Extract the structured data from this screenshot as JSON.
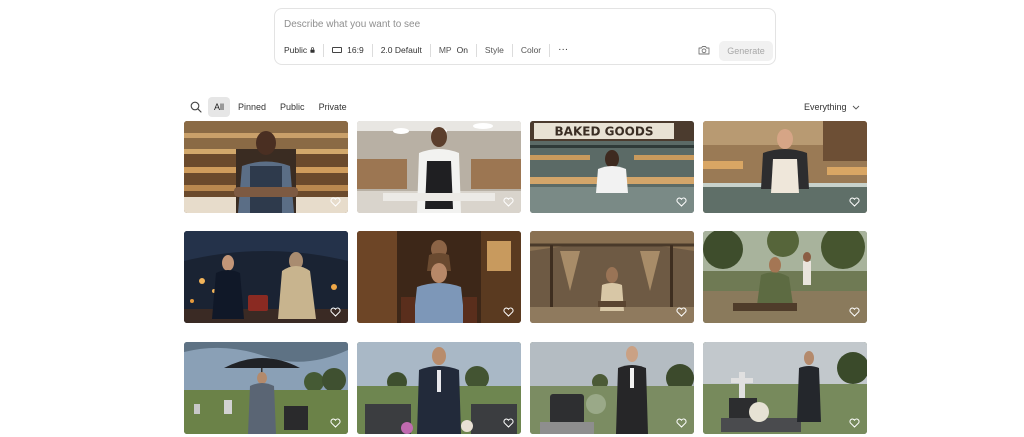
{
  "prompt": {
    "placeholder": "Describe what you want to see",
    "value": ""
  },
  "toolbar": {
    "visibility_label": "Public",
    "aspect_ratio_label": "16:9",
    "model_label": "2.0 Default",
    "mp_label": "MP",
    "mp_state": "On",
    "style_label": "Style",
    "color_label": "Color",
    "more_label": "···",
    "generate_label": "Generate"
  },
  "filters": {
    "tabs": [
      {
        "label": "All",
        "active": true
      },
      {
        "label": "Pinned",
        "active": false
      },
      {
        "label": "Public",
        "active": false
      },
      {
        "label": "Private",
        "active": false
      }
    ],
    "scope_label": "Everything"
  },
  "gallery": {
    "images": [
      {
        "subject": "baker-arms-crossed-bakery",
        "palette": "warm"
      },
      {
        "subject": "baker-leaning-on-counter",
        "palette": "bright"
      },
      {
        "subject": "baker-under-baked-goods-sign",
        "palette": "teal"
      },
      {
        "subject": "baker-at-display-case",
        "palette": "warm"
      },
      {
        "subject": "man-with-fortune-teller",
        "palette": "night"
      },
      {
        "subject": "man-in-barber-chair",
        "palette": "amber"
      },
      {
        "subject": "man-seated-in-thatched-hut",
        "palette": "earth"
      },
      {
        "subject": "man-seated-in-park",
        "palette": "green"
      },
      {
        "subject": "man-with-umbrella-cemetery",
        "palette": "sky"
      },
      {
        "subject": "man-in-suit-at-grave",
        "palette": "sky"
      },
      {
        "subject": "man-at-headstone",
        "palette": "overcast"
      },
      {
        "subject": "man-by-cross-grave",
        "palette": "overcast"
      }
    ]
  },
  "colors": {
    "accent_border": "#e3e3e3",
    "active_tab_bg": "#e6e6e6",
    "generate_bg": "#f1f1f1"
  }
}
